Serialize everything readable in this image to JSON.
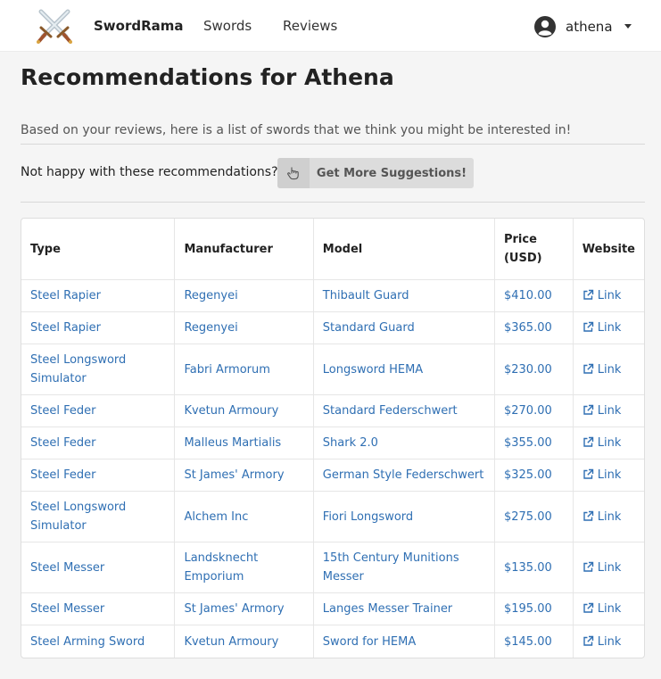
{
  "nav": {
    "brand": "SwordRama",
    "links": [
      "Swords",
      "Reviews"
    ],
    "user": "athena"
  },
  "page": {
    "title": "Recommendations for Athena",
    "intro": "Based on your reviews, here is a list of swords that we think you might be interested in!",
    "unhappy_text": "Not happy with these recommendations?",
    "more_button": "Get More Suggestions!"
  },
  "table": {
    "headers": [
      "Type",
      "Manufacturer",
      "Model",
      "Price (USD)",
      "Website"
    ],
    "rows": [
      {
        "type": "Steel Rapier",
        "manufacturer": "Regenyei",
        "model": "Thibault Guard",
        "price": "$410.00",
        "website": "Link"
      },
      {
        "type": "Steel Rapier",
        "manufacturer": "Regenyei",
        "model": "Standard Guard",
        "price": "$365.00",
        "website": "Link"
      },
      {
        "type": "Steel Longsword Simulator",
        "manufacturer": "Fabri Armorum",
        "model": "Longsword HEMA",
        "price": "$230.00",
        "website": "Link"
      },
      {
        "type": "Steel Feder",
        "manufacturer": "Kvetun Armoury",
        "model": "Standard Federschwert",
        "price": "$270.00",
        "website": "Link"
      },
      {
        "type": "Steel Feder",
        "manufacturer": "Malleus Martialis",
        "model": "Shark 2.0",
        "price": "$355.00",
        "website": "Link"
      },
      {
        "type": "Steel Feder",
        "manufacturer": "St James' Armory",
        "model": "German Style Federschwert",
        "price": "$325.00",
        "website": "Link"
      },
      {
        "type": "Steel Longsword Simulator",
        "manufacturer": "Alchem Inc",
        "model": "Fiori Longsword",
        "price": "$275.00",
        "website": "Link"
      },
      {
        "type": "Steel Messer",
        "manufacturer": "Landsknecht Emporium",
        "model": "15th Century Munitions Messer",
        "price": "$135.00",
        "website": "Link"
      },
      {
        "type": "Steel Messer",
        "manufacturer": "St James' Armory",
        "model": "Langes Messer Trainer",
        "price": "$195.00",
        "website": "Link"
      },
      {
        "type": "Steel Arming Sword",
        "manufacturer": "Kvetun Armoury",
        "model": "Sword for HEMA",
        "price": "$145.00",
        "website": "Link"
      }
    ]
  },
  "colors": {
    "link": "#2f6fb3",
    "button": "#dcdcdc"
  },
  "icons": [
    "crossed-swords-logo",
    "user-circle-icon",
    "caret-down-icon",
    "pointing-hand-icon",
    "external-link-icon"
  ]
}
